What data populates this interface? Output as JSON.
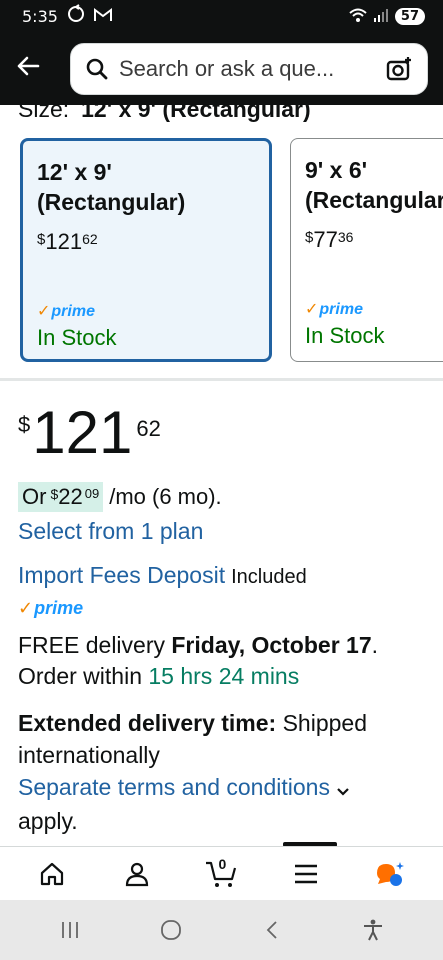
{
  "status_bar": {
    "time": "5:35",
    "battery": "57",
    "icons": [
      "sync-icon",
      "gmail-icon",
      "wifi-icon",
      "signal-icon",
      "battery-icon"
    ]
  },
  "header": {
    "search_placeholder": "Search or ask a que...",
    "icons": [
      "back-arrow-icon",
      "search-icon",
      "camera-icon"
    ]
  },
  "size_selector": {
    "label": "Size:",
    "selected_value": "12' x 9' (Rectangular)",
    "options": [
      {
        "name_line1": "12' x 9'",
        "name_line2": "(Rectangular)",
        "currency": "$",
        "price_whole": "121",
        "price_fraction": "62",
        "prime": "prime",
        "stock": "In Stock",
        "selected": true
      },
      {
        "name_line1": "9' x 6'",
        "name_line2": "(Rectangular)",
        "currency": "$",
        "price_whole": "77",
        "price_fraction": "36",
        "prime": "prime",
        "stock": "In Stock",
        "selected": false
      }
    ]
  },
  "price": {
    "currency": "$",
    "whole": "121",
    "fraction": "62"
  },
  "installment": {
    "prefix": "Or",
    "currency": "$",
    "whole": "22",
    "fraction": "09",
    "suffix": "/mo (6 mo)."
  },
  "select_plan_link": "Select from 1 plan",
  "import_fees": {
    "link": "Import Fees Deposit",
    "status": "Included"
  },
  "prime_label": "prime",
  "delivery": {
    "prefix": "FREE delivery",
    "date": "Friday, October 17",
    "period": ".",
    "order_within": "Order within",
    "countdown": "15 hrs 24 mins"
  },
  "extended": {
    "label": "Extended delivery time:",
    "text": "Shipped internationally",
    "terms_link": "Separate terms and conditions",
    "apply": "apply."
  },
  "bottom_nav": {
    "items": [
      "home-icon",
      "account-icon",
      "cart-icon",
      "menu-icon",
      "rufus-icon"
    ],
    "cart_count": "0",
    "colors": {
      "rufus_orange": "#ff6f00",
      "rufus_blue": "#1a73e8"
    }
  },
  "system_nav": [
    "recents-icon",
    "home-circle-icon",
    "back-chevron-icon",
    "accessibility-icon"
  ],
  "colors": {
    "link": "#2162a1",
    "in_stock": "#007600",
    "countdown": "#067d62",
    "selected_border": "#2162a1",
    "installment_highlight": "#d5f0e8",
    "prime_blue": "#1a98ff",
    "prime_check": "#f08804"
  }
}
